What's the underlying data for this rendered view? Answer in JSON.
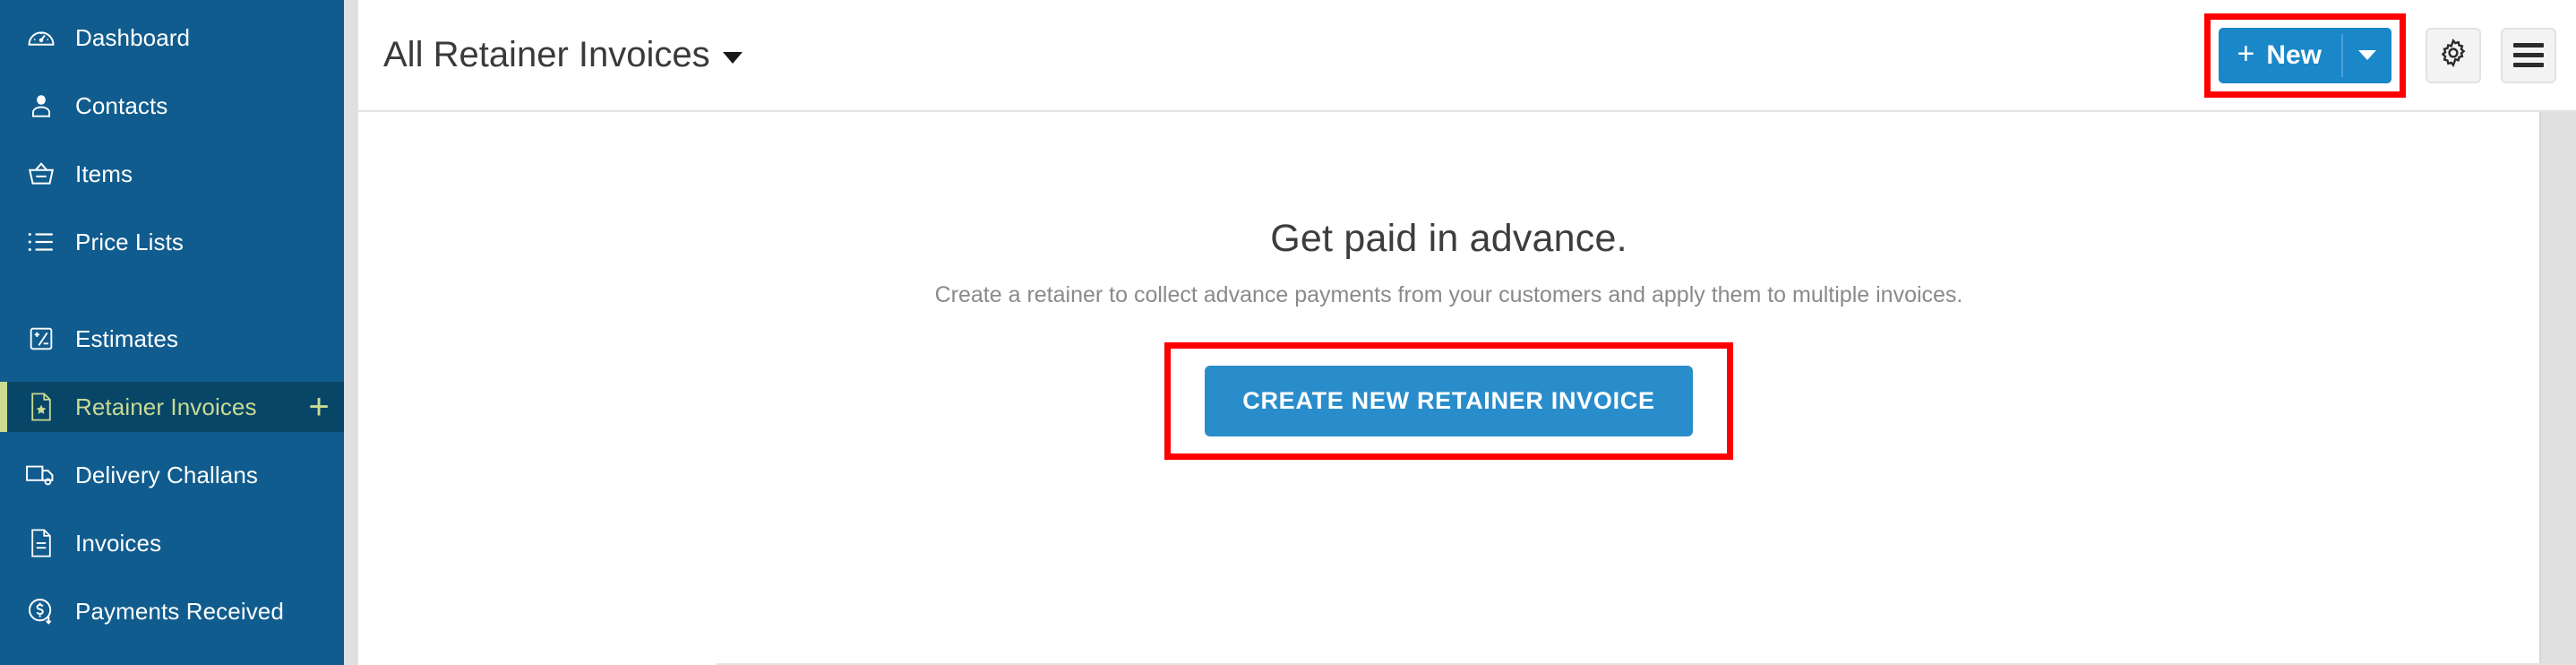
{
  "sidebar": {
    "background_color": "#115c8e",
    "active_background_color": "#084668",
    "accent_color": "#c9da92",
    "groups": [
      {
        "items": [
          {
            "label": "Dashboard",
            "icon": "dashboard-gauge-icon",
            "active": false
          },
          {
            "label": "Contacts",
            "icon": "user-icon",
            "active": false
          },
          {
            "label": "Items",
            "icon": "basket-icon",
            "active": false
          },
          {
            "label": "Price Lists",
            "icon": "list-icon",
            "active": false
          }
        ]
      },
      {
        "items": [
          {
            "label": "Estimates",
            "icon": "estimate-document-icon",
            "active": false
          },
          {
            "label": "Retainer Invoices",
            "icon": "retainer-document-star-icon",
            "active": true,
            "add_label": "+",
            "add_icon": "plus-icon"
          },
          {
            "label": "Delivery Challans",
            "icon": "truck-icon",
            "active": false
          },
          {
            "label": "Invoices",
            "icon": "invoice-document-icon",
            "active": false
          },
          {
            "label": "Payments Received",
            "icon": "dollar-circle-down-icon",
            "active": false
          }
        ]
      }
    ]
  },
  "topbar": {
    "page_title": "All Retainer Invoices",
    "title_caret_icon": "chevron-down-icon",
    "new_button": {
      "label": "New",
      "plus": "+",
      "plus_icon": "plus-icon",
      "dropdown_icon": "chevron-down-icon",
      "color": "#1a87c8"
    },
    "settings_button": {
      "icon": "gear-icon"
    },
    "menu_button": {
      "icon": "hamburger-icon"
    }
  },
  "empty_state": {
    "headline": "Get paid in advance.",
    "subtext": "Create a retainer to collect advance payments from your customers and apply them to multiple invoices.",
    "cta_label": "CREATE NEW RETAINER INVOICE",
    "cta_color": "#2a8dcb"
  },
  "annotations": {
    "highlight_color": "#ff0000",
    "highlighted_elements": [
      "new-button",
      "sidebar-add-retainer-invoice",
      "create-new-retainer-invoice-button"
    ]
  }
}
